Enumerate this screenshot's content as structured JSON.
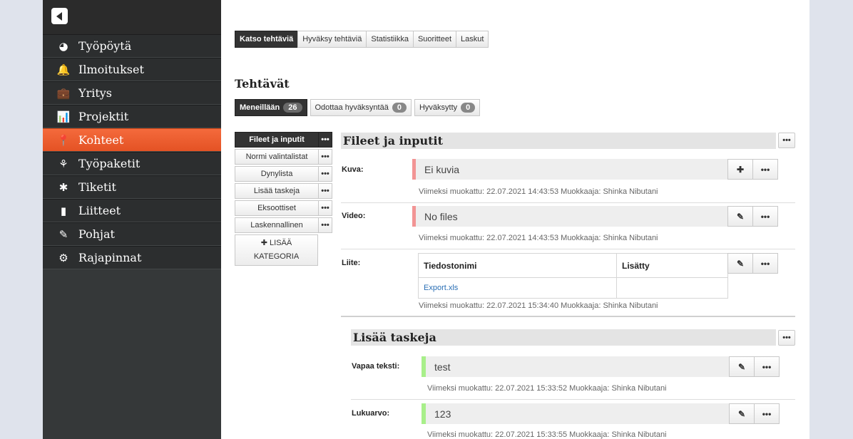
{
  "sidebar": {
    "items": [
      {
        "label": "Työpöytä",
        "icon": "gauge-icon",
        "glyph": "◕",
        "active": false
      },
      {
        "label": "Ilmoitukset",
        "icon": "bell-icon",
        "glyph": "🔔",
        "active": false
      },
      {
        "label": "Yritys",
        "icon": "briefcase-icon",
        "glyph": "💼",
        "active": false
      },
      {
        "label": "Projektit",
        "icon": "bar-chart-icon",
        "glyph": "📊",
        "active": false
      },
      {
        "label": "Kohteet",
        "icon": "map-marker-icon",
        "glyph": "📍",
        "active": true
      },
      {
        "label": "Työpaketit",
        "icon": "sitemap-icon",
        "glyph": "⚘",
        "active": false
      },
      {
        "label": "Tiketit",
        "icon": "bug-icon",
        "glyph": "✱",
        "active": false
      },
      {
        "label": "Liitteet",
        "icon": "file-icon",
        "glyph": "▮",
        "active": false
      },
      {
        "label": "Pohjat",
        "icon": "pencil-icon",
        "glyph": "✎",
        "active": false
      },
      {
        "label": "Rajapinnat",
        "icon": "cogs-icon",
        "glyph": "⚙",
        "active": false
      }
    ]
  },
  "topnav": {
    "tabs": [
      "Katso tehtäviä",
      "Hyväksy tehtäviä",
      "Statistiikka",
      "Suoritteet",
      "Laskut"
    ]
  },
  "page_title": "Tehtävät",
  "status_tabs": [
    {
      "label": "Meneillään",
      "count": "26"
    },
    {
      "label": "Odottaa hyväksyntää",
      "count": "0"
    },
    {
      "label": "Hyväksytty",
      "count": "0"
    }
  ],
  "categories": [
    "Fileet ja inputit",
    "Normi valintalistat",
    "Dynylista",
    "Lisää taskeja",
    "Eksoottiset",
    "Laskennallinen"
  ],
  "add_category": {
    "plus": "✚",
    "line1": "LISÄÄ",
    "line2": "KATEGORIA"
  },
  "section1": {
    "title": "Fileet ja inputit",
    "kuva": {
      "label": "Kuva:",
      "value": "Ei kuvia",
      "meta": "Viimeksi muokattu: 22.07.2021 14:43:53 Muokkaaja: Shinka Nibutani"
    },
    "video": {
      "label": "Video:",
      "value": "No files",
      "meta": "Viimeksi muokattu: 22.07.2021 14:43:53 Muokkaaja: Shinka Nibutani"
    },
    "liite": {
      "label": "Liite:",
      "col1": "Tiedostonimi",
      "col2": "Lisätty",
      "file": "Export.xls",
      "added": "",
      "meta": "Viimeksi muokattu: 22.07.2021 15:34:40 Muokkaaja: Shinka Nibutani"
    }
  },
  "section2": {
    "title": "Lisää taskeja",
    "vapaa": {
      "label": "Vapaa teksti:",
      "value": "test",
      "meta": "Viimeksi muokattu: 22.07.2021 15:33:52 Muokkaaja: Shinka Nibutani"
    },
    "luku": {
      "label": "Lukuarvo:",
      "value": "123",
      "meta": "Viimeksi muokattu: 22.07.2021 15:33:55 Muokkaaja: Shinka Nibutani"
    }
  },
  "glyphs": {
    "dots": "•••",
    "plus": "✚",
    "edit": "✎"
  }
}
